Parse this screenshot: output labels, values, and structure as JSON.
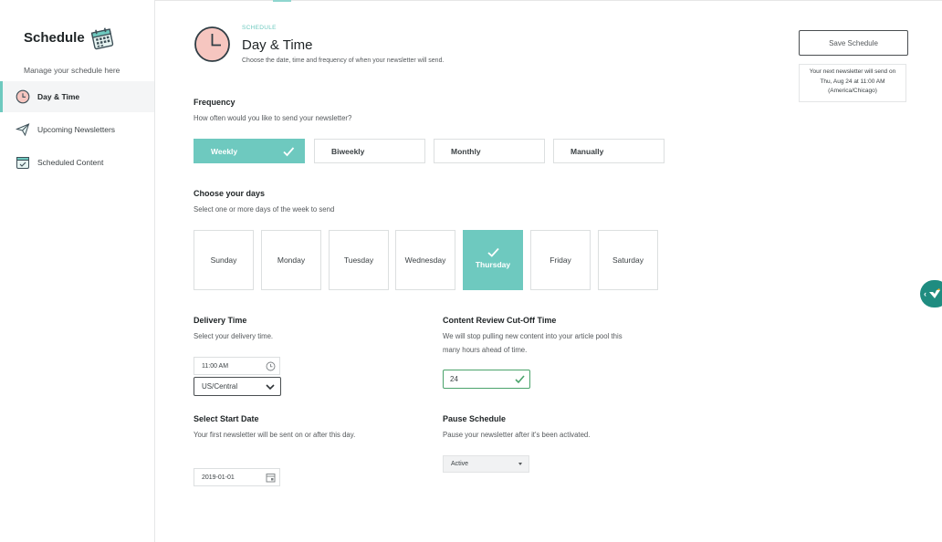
{
  "colors": {
    "accent": "#6ec9bf",
    "success": "#4aa36b",
    "text": "#1f2426",
    "muted": "#55595c",
    "clockFill": "#f6c6c0"
  },
  "sidebar": {
    "title": "Schedule",
    "subtitle": "Manage your schedule here",
    "items": [
      {
        "label": "Day & Time",
        "icon": "clock-icon",
        "active": true
      },
      {
        "label": "Upcoming Newsletters",
        "icon": "paper-plane-icon",
        "active": false
      },
      {
        "label": "Scheduled Content",
        "icon": "calendar-check-icon",
        "active": false
      }
    ]
  },
  "header": {
    "section_label": "SCHEDULE",
    "title": "Day & Time",
    "description": "Choose the date, time and frequency of when your newsletter will send."
  },
  "actions": {
    "save_label": "Save Schedule",
    "next_send": "Your next newsletter will send on Thu, Aug 24 at 11:00 AM (America/Chicago)"
  },
  "frequency": {
    "title": "Frequency",
    "description": "How often would you like to send your newsletter?",
    "options": [
      "Weekly",
      "Biweekly",
      "Monthly",
      "Manually"
    ],
    "selected": "Weekly"
  },
  "days": {
    "title": "Choose your days",
    "description": "Select one or more days of the week to send",
    "options": [
      "Sunday",
      "Monday",
      "Tuesday",
      "Wednesday",
      "Thursday",
      "Friday",
      "Saturday"
    ],
    "selected": [
      "Thursday"
    ]
  },
  "delivery": {
    "title": "Delivery Time",
    "description": "Select your delivery time.",
    "time_value": "11:00 AM",
    "timezone_value": "US/Central"
  },
  "cutoff": {
    "title": "Content Review Cut-Off Time",
    "description": "We will stop pulling new content into your article pool this many hours ahead of time.",
    "value": "24"
  },
  "start_date": {
    "title": "Select Start Date",
    "description": "Your first newsletter will be sent on or after this day.",
    "value": "2019-01-01"
  },
  "pause": {
    "title": "Pause Schedule",
    "description": "Pause your newsletter after it's been activated.",
    "value": "Active"
  }
}
